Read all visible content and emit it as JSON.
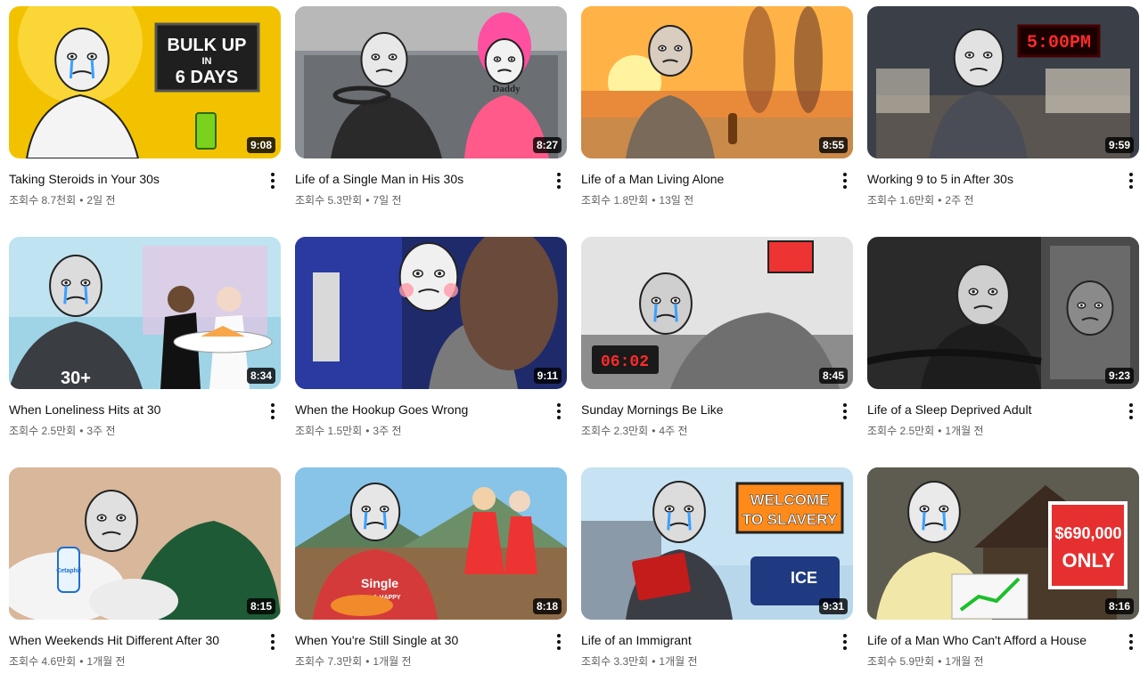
{
  "videos": [
    {
      "title": "Taking Steroids in Your 30s",
      "views": "조회수 8.7천회",
      "age": "2일 전",
      "duration": "9:08",
      "thumb_text": "BULK UP IN 6 DAYS",
      "bg": "#f2c200"
    },
    {
      "title": "Life of a Single Man in His 30s",
      "views": "조회수 5.3만회",
      "age": "7일 전",
      "duration": "8:27",
      "thumb_text": "Daddy",
      "bg": "#8a8f94"
    },
    {
      "title": "Life of a Man Living Alone",
      "views": "조회수 1.8만회",
      "age": "13일 전",
      "duration": "8:55",
      "thumb_text": "",
      "bg": "#f7a23a"
    },
    {
      "title": "Working 9 to 5 in After 30s",
      "views": "조회수 1.6만회",
      "age": "2주 전",
      "duration": "9:59",
      "thumb_text": "5:00PM",
      "bg": "#3a3f48"
    },
    {
      "title": "When Loneliness Hits at 30",
      "views": "조회수 2.5만회",
      "age": "3주 전",
      "duration": "8:34",
      "thumb_text": "30+",
      "bg": "#9fd3e6"
    },
    {
      "title": "When the Hookup Goes Wrong",
      "views": "조회수 1.5만회",
      "age": "3주 전",
      "duration": "9:11",
      "thumb_text": "",
      "bg": "#1f2a6b"
    },
    {
      "title": "Sunday Mornings Be Like",
      "views": "조회수 2.3만회",
      "age": "4주 전",
      "duration": "8:45",
      "thumb_text": "06:02",
      "bg": "#cfcfcf"
    },
    {
      "title": "Life of a Sleep Deprived Adult",
      "views": "조회수 2.5만회",
      "age": "1개월 전",
      "duration": "9:23",
      "thumb_text": "",
      "bg": "#2a2a2a"
    },
    {
      "title": "When Weekends Hit Different After 30",
      "views": "조회수 4.6만회",
      "age": "1개월 전",
      "duration": "8:15",
      "thumb_text": "Cetaphil",
      "bg": "#c9a88a"
    },
    {
      "title": "When You're Still Single at 30",
      "views": "조회수 7.3만회",
      "age": "1개월 전",
      "duration": "8:18",
      "thumb_text": "Single & HAPPY",
      "bg": "#6fb3d9"
    },
    {
      "title": "Life of an Immigrant",
      "views": "조회수 3.3만회",
      "age": "1개월 전",
      "duration": "9:31",
      "thumb_text": "WELCOME TO SLAVERY",
      "bg": "#b8d7ea"
    },
    {
      "title": "Life of a Man Who Can't Afford a House",
      "views": "조회수 5.9만회",
      "age": "1개월 전",
      "duration": "8:16",
      "thumb_text": "$690,000 ONLY",
      "bg": "#6e6a5c"
    }
  ],
  "separator": "•"
}
